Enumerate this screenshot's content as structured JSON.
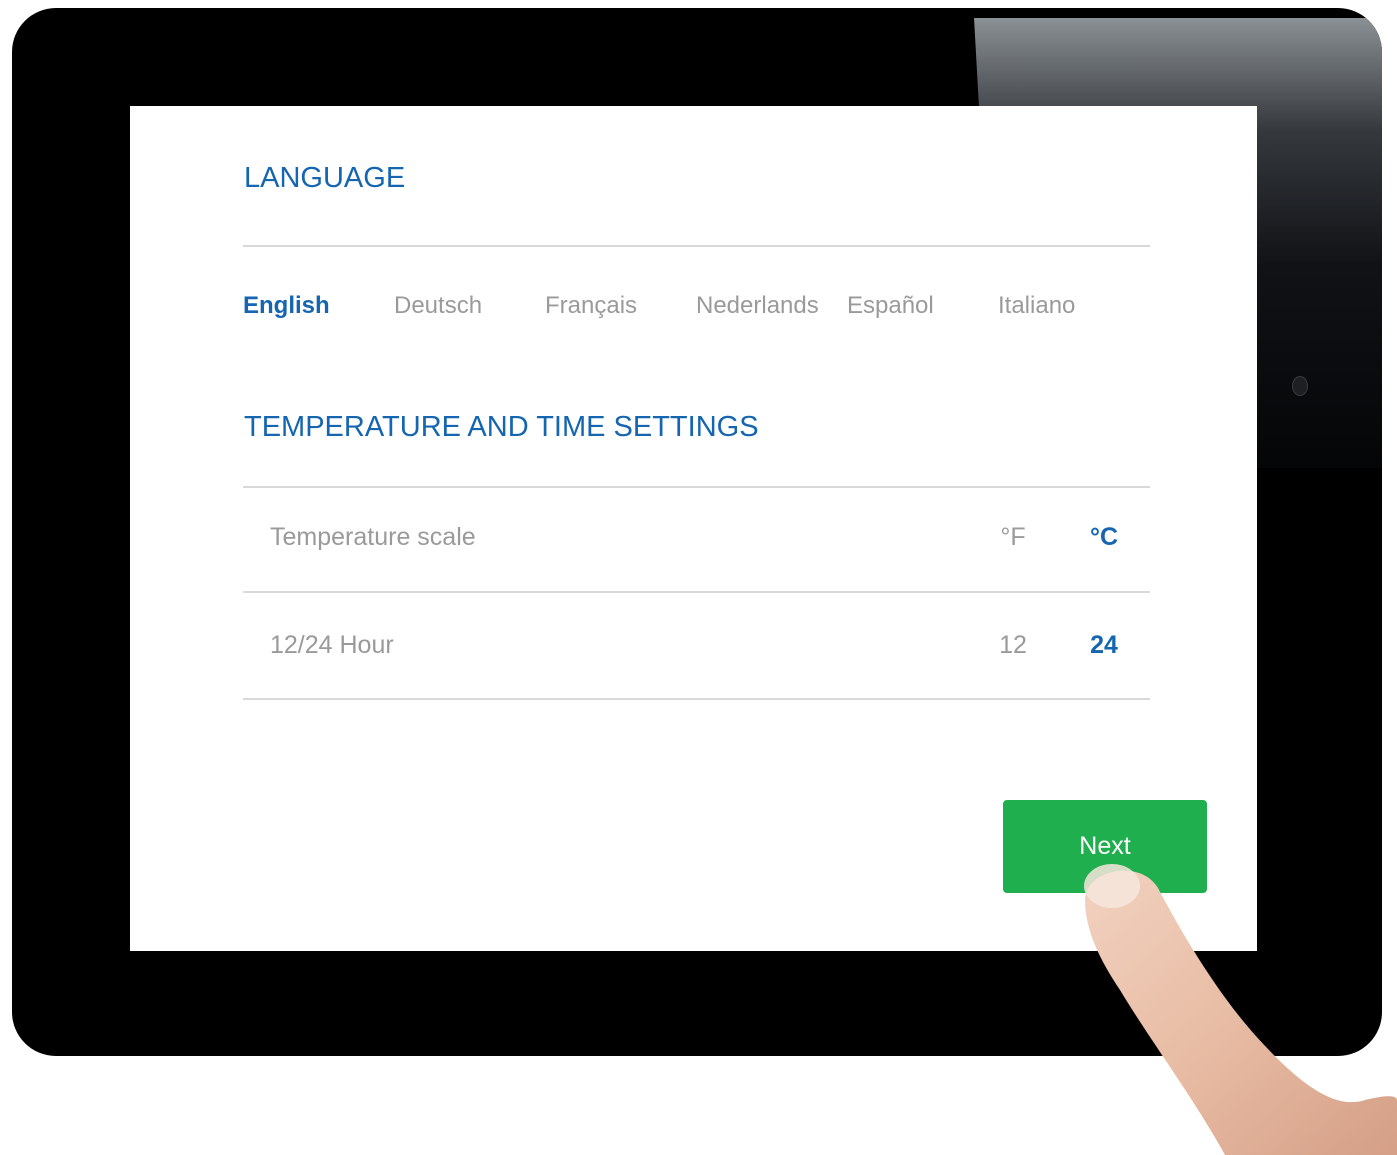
{
  "language": {
    "title": "LANGUAGE",
    "options": [
      {
        "label": "English",
        "active": true
      },
      {
        "label": "Deutsch",
        "active": false
      },
      {
        "label": "Français",
        "active": false
      },
      {
        "label": "Nederlands",
        "active": false
      },
      {
        "label": "Español",
        "active": false
      },
      {
        "label": "Italiano",
        "active": false
      }
    ]
  },
  "temperature_time": {
    "title": "TEMPERATURE AND TIME SETTINGS",
    "temperature_scale": {
      "label": "Temperature scale",
      "options": [
        {
          "label": "°F",
          "active": false
        },
        {
          "label": "°C",
          "active": true
        }
      ]
    },
    "hour_format": {
      "label": "12/24 Hour",
      "options": [
        {
          "label": "12",
          "active": false
        },
        {
          "label": "24",
          "active": true
        }
      ]
    }
  },
  "next_button": {
    "label": "Next"
  },
  "colors": {
    "accent": "#1565b0",
    "inactive_text": "#9a9a9a",
    "button_green": "#1faf4f",
    "divider": "#d9d9d9"
  }
}
